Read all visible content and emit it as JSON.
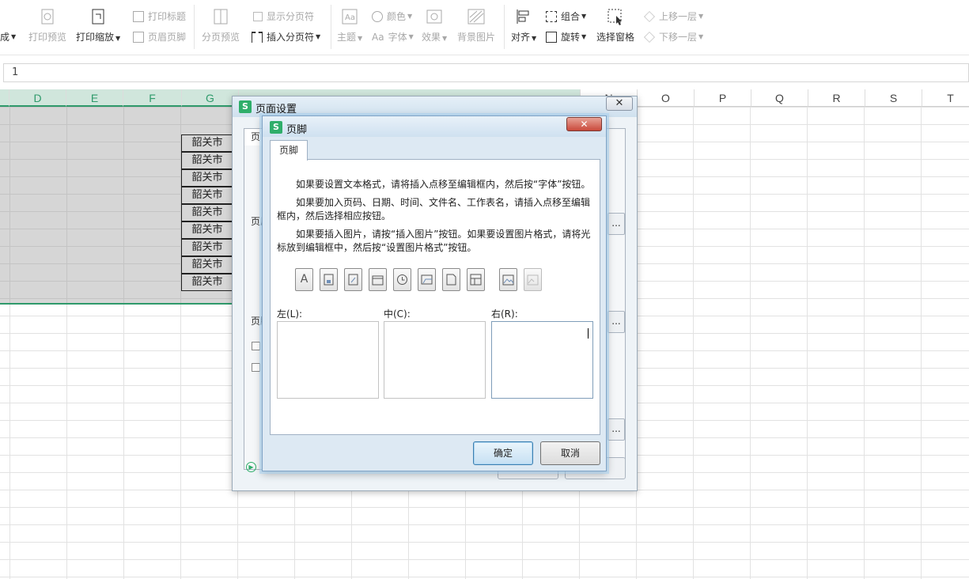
{
  "ribbon": {
    "cut_label": "成",
    "print_preview": "打印预览",
    "print_scale": "打印缩放",
    "print_title": "打印标题",
    "header_footer": "页眉页脚",
    "page_break_preview": "分页预览",
    "show_page_breaks": "显示分页符",
    "insert_page_break": "插入分页符",
    "theme": "主题",
    "colors": "颜色",
    "font_glyph": "Aa",
    "fonts": "字体",
    "effects": "效果",
    "background": "背景图片",
    "align": "对齐",
    "group": "组合",
    "rotate": "旋转",
    "selection_pane": "选择窗格",
    "bring_forward": "上移一层",
    "send_backward": "下移一层"
  },
  "formula_bar": {
    "value": "1"
  },
  "columns": {
    "D": "D",
    "E": "E",
    "F": "F",
    "G": "G",
    "N": "N",
    "O": "O",
    "P": "P",
    "Q": "Q",
    "R": "R",
    "S": "S",
    "T": "T"
  },
  "cells": [
    "韶关市",
    "韶关市",
    "韶关市",
    "韶关市",
    "韶关市",
    "韶关市",
    "韶关市",
    "韶关市",
    "韶关市"
  ],
  "page_setup_dialog": {
    "title": "页面设置",
    "app_icon": "S",
    "tab_partial": "页",
    "header_label_partial": "页眉",
    "footer_label_partial": "页脚",
    "slot_button": "..."
  },
  "footer_dialog": {
    "title": "页脚",
    "app_icon": "S",
    "tab": "页脚",
    "close": "✕",
    "para1": "如果要设置文本格式，请将插入点移至编辑框内，然后按“字体”按钮。",
    "para2": "如果要加入页码、日期、时间、文件名、工作表名，请插入点移至编辑框内，然后选择相应按钮。",
    "para3": "如果要插入图片，请按“插入图片”按钮。如果要设置图片格式，请将光标放到编辑框中，然后按“设置图片格式”按钮。",
    "tool_font_glyph": "A",
    "left_label": "左(L):",
    "center_label": "中(C):",
    "right_label": "右(R):",
    "ok": "确定",
    "cancel": "取消"
  },
  "colors": {
    "accent_green": "#2f9a6b",
    "selection_gray": "#d6d6d6",
    "dialog_blue": "#dde9f3"
  }
}
